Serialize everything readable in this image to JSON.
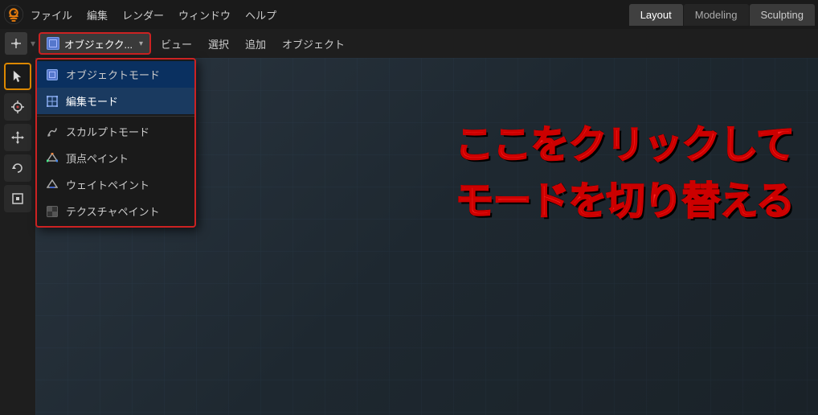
{
  "topbar": {
    "menu_items": [
      "ファイル",
      "編集",
      "レンダー",
      "ウィンドウ",
      "ヘルプ"
    ],
    "workspace_tabs": [
      {
        "label": "Layout",
        "active": true
      },
      {
        "label": "Modeling",
        "active": false
      },
      {
        "label": "Sculpting",
        "active": false
      }
    ]
  },
  "toolbar": {
    "mode_selector_text": "オブジェクク...",
    "menu_items": [
      "ビュー",
      "選択",
      "追加",
      "オブジェクト"
    ]
  },
  "dropdown": {
    "items": [
      {
        "label": "オブジェクトモード",
        "icon": "object-mode-icon",
        "selected": true
      },
      {
        "label": "編集モード",
        "icon": "edit-mode-icon",
        "highlighted": true
      },
      {
        "label": "スカルプトモード",
        "icon": "sculpt-icon"
      },
      {
        "label": "頂点ペイント",
        "icon": "vertex-paint-icon"
      },
      {
        "label": "ウェイトペイント",
        "icon": "weight-paint-icon"
      },
      {
        "label": "テクスチャペイント",
        "icon": "texture-paint-icon"
      }
    ]
  },
  "annotation": {
    "line1": "ここをクリックして",
    "line2": "モードを切り替える"
  },
  "sidebar_tools": [
    {
      "icon": "▶",
      "name": "select-tool",
      "active_orange": true
    },
    {
      "icon": "⊕",
      "name": "cursor-tool"
    },
    {
      "icon": "✥",
      "name": "move-tool"
    },
    {
      "icon": "↺",
      "name": "rotate-tool"
    },
    {
      "icon": "⊡",
      "name": "transform-tool"
    }
  ]
}
